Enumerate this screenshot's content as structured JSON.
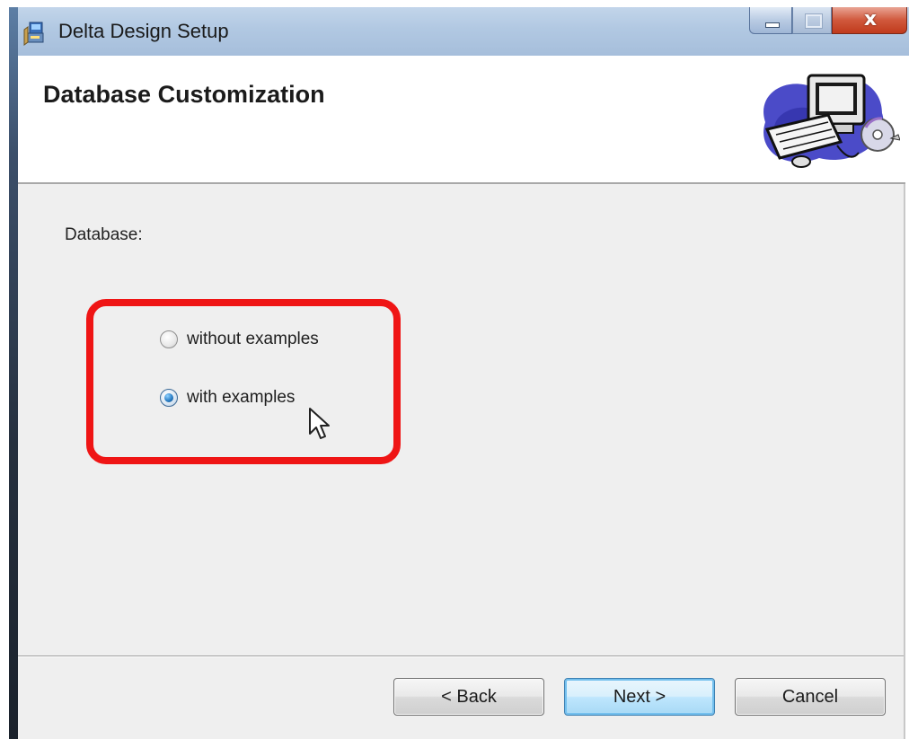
{
  "window": {
    "title": "Delta Design Setup"
  },
  "titlebar": {
    "icons": {
      "app": "installer-icon",
      "minimize": "minimize-icon",
      "maximize": "maximize-icon",
      "close": "close-icon"
    },
    "close_glyph": "x"
  },
  "header": {
    "title": "Database Customization",
    "art_icon": "computer-cd-icon"
  },
  "database": {
    "label": "Database:",
    "options": [
      {
        "label": "without examples",
        "selected": false
      },
      {
        "label": "with examples",
        "selected": true
      }
    ]
  },
  "annotation": {
    "highlight_color": "#ef1515",
    "cursor_icon": "mouse-cursor-icon"
  },
  "buttons": {
    "back": "< Back",
    "next": "Next >",
    "cancel": "Cancel",
    "default": "next"
  }
}
